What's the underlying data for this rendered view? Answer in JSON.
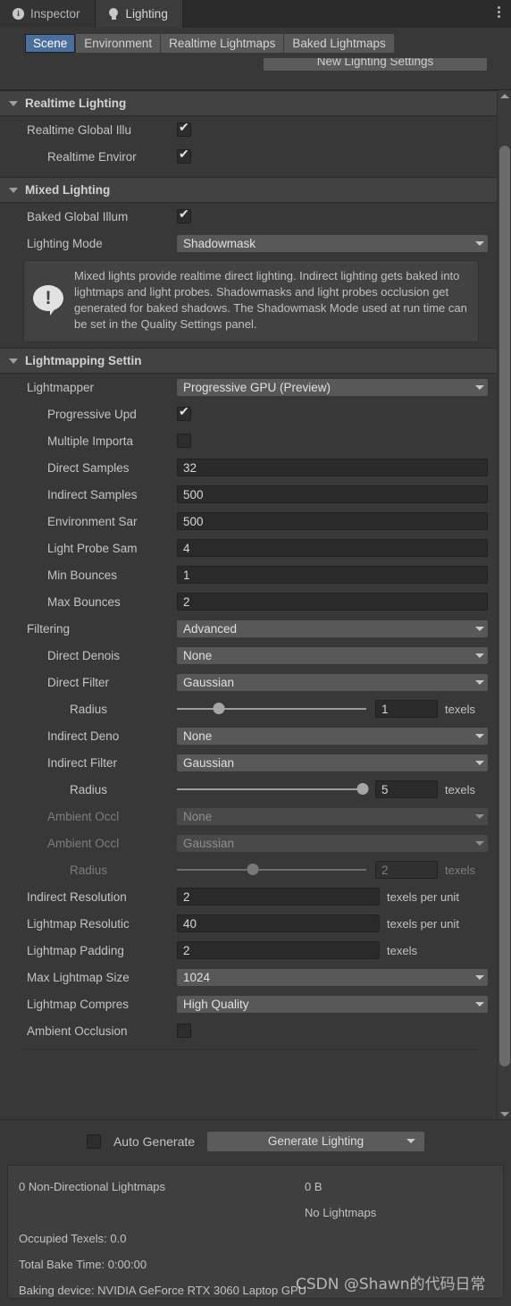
{
  "window": {
    "tabs": [
      {
        "label": "Inspector",
        "icon": "info-icon",
        "active": false
      },
      {
        "label": "Lighting",
        "icon": "lightbulb-icon",
        "active": true
      }
    ],
    "menu_icon": "kebab-menu-icon"
  },
  "subtabs": [
    {
      "label": "Scene",
      "selected": true
    },
    {
      "label": "Environment",
      "selected": false
    },
    {
      "label": "Realtime Lightmaps",
      "selected": false
    },
    {
      "label": "Baked Lightmaps",
      "selected": false
    }
  ],
  "toolbar": {
    "new_settings_label": "New Lighting Settings"
  },
  "sections": {
    "realtime_lighting": {
      "title": "Realtime Lighting",
      "rows": [
        {
          "label": "Realtime Global Illu",
          "value": "checked"
        },
        {
          "label": "Realtime Enviror",
          "value": "checked"
        }
      ]
    },
    "mixed_lighting": {
      "title": "Mixed Lighting",
      "baked_gi_label": "Baked Global Illum",
      "baked_gi_value": "checked",
      "lighting_mode_label": "Lighting Mode",
      "lighting_mode_value": "Shadowmask",
      "info_text": "Mixed lights provide realtime direct lighting. Indirect lighting gets baked into lightmaps and light probes. Shadowmasks and light probes occlusion get generated for baked shadows. The Shadowmask Mode used at run time can be set in the Quality Settings panel."
    },
    "lightmapping": {
      "title": "Lightmapping Settin",
      "lightmapper_label": "Lightmapper",
      "lightmapper_value": "Progressive GPU (Preview)",
      "progressive_updates_label": "Progressive Upd",
      "progressive_updates_value": "checked",
      "multiple_importance_label": "Multiple Importa",
      "multiple_importance_value": "unchecked",
      "direct_samples_label": "Direct Samples",
      "direct_samples_value": "32",
      "indirect_samples_label": "Indirect Samples",
      "indirect_samples_value": "500",
      "environment_samples_label": "Environment Sar",
      "environment_samples_value": "500",
      "light_probe_samples_label": "Light Probe Sam",
      "light_probe_samples_value": "4",
      "min_bounces_label": "Min Bounces",
      "min_bounces_value": "1",
      "max_bounces_label": "Max Bounces",
      "max_bounces_value": "2",
      "filtering_label": "Filtering",
      "filtering_value": "Advanced",
      "direct_denoiser_label": "Direct Denois",
      "direct_denoiser_value": "None",
      "direct_filter_label": "Direct Filter",
      "direct_filter_value": "Gaussian",
      "direct_radius_label": "Radius",
      "direct_radius_value": "1",
      "direct_radius_unit": "texels",
      "indirect_denoiser_label": "Indirect Deno",
      "indirect_denoiser_value": "None",
      "indirect_filter_label": "Indirect Filter",
      "indirect_filter_value": "Gaussian",
      "indirect_radius_label": "Radius",
      "indirect_radius_value": "5",
      "indirect_radius_unit": "texels",
      "ao_denoiser_label": "Ambient Occl",
      "ao_denoiser_value": "None",
      "ao_filter_label": "Ambient Occl",
      "ao_filter_value": "Gaussian",
      "ao_radius_label": "Radius",
      "ao_radius_value": "2",
      "ao_radius_unit": "texels",
      "indirect_resolution_label": "Indirect Resolution",
      "indirect_resolution_value": "2",
      "indirect_resolution_unit": "texels per unit",
      "lightmap_resolution_label": "Lightmap Resolutic",
      "lightmap_resolution_value": "40",
      "lightmap_resolution_unit": "texels per unit",
      "lightmap_padding_label": "Lightmap Padding",
      "lightmap_padding_value": "2",
      "lightmap_padding_unit": "texels",
      "max_lightmap_size_label": "Max Lightmap Size",
      "max_lightmap_size_value": "1024",
      "lightmap_compression_label": "Lightmap Compres",
      "lightmap_compression_value": "High Quality",
      "ambient_occlusion_label": "Ambient Occlusion",
      "ambient_occlusion_value": "unchecked"
    }
  },
  "bottom": {
    "auto_generate_label": "Auto Generate",
    "auto_generate_value": "unchecked",
    "generate_button_label": "Generate Lighting"
  },
  "stats": {
    "lightmaps_count": "0 Non-Directional Lightmaps",
    "lightmaps_size": "0 B",
    "no_lightmaps": "No Lightmaps",
    "occupied_texels": "Occupied Texels: 0.0",
    "total_bake_time": "Total Bake Time: 0:00:00",
    "baking_device": "Baking device: NVIDIA GeForce RTX 3060 Laptop GPU",
    "watermark": "CSDN @Shawn的代码日常"
  },
  "colors": {
    "accent": "#4a6f9c",
    "panel": "#383838",
    "section_header": "#424242",
    "dropdown": "#585858",
    "field": "#2a2a2a"
  },
  "slider_positions": {
    "direct_radius_pct": 22,
    "indirect_radius_pct": 98,
    "ao_radius_pct": 40
  }
}
